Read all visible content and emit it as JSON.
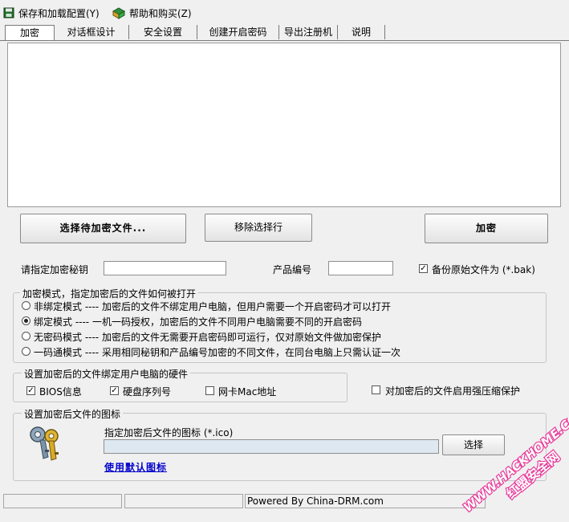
{
  "menu": {
    "save_load": "保存和加载配置(Y)",
    "help_buy": "帮助和购买(Z)"
  },
  "tabs": [
    "加密",
    "对话框设计",
    "安全设置",
    "创建开启密码",
    "导出注册机",
    "说明"
  ],
  "buttons": {
    "select_files": "选择待加密文件...",
    "remove_selected": "移除选择行",
    "encrypt": "加密",
    "choose_icon": "选择"
  },
  "fields": {
    "key_label": "请指定加密秘钥",
    "key_value": "",
    "product_label": "产品编号",
    "product_value": "",
    "backup_label": "备份原始文件为 (*.bak)",
    "backup_checked": true
  },
  "mode_group": {
    "title": "加密模式，指定加密后的文件如何被打开",
    "options": [
      {
        "label": "非绑定模式 ---- 加密后的文件不绑定用户电脑，但用户需要一个开启密码才可以打开",
        "selected": false
      },
      {
        "label": "绑定模式 ---- 一机一码授权，加密后的文件不同用户电脑需要不同的开启密码",
        "selected": true
      },
      {
        "label": "无密码模式 ---- 加密后的文件无需要开启密码即可运行，仅对原始文件做加密保护",
        "selected": false
      },
      {
        "label": "一码通模式 ---- 采用相同秘钥和产品编号加密的不同文件，在同台电脑上只需认证一次",
        "selected": false
      }
    ]
  },
  "hardware_group": {
    "title": "设置加密后的文件绑定用户电脑的硬件",
    "bios": "BIOS信息",
    "disk": "硬盘序列号",
    "mac": "网卡Mac地址",
    "bios_checked": true,
    "disk_checked": true,
    "mac_checked": false
  },
  "compress": {
    "label": "对加密后的文件启用强压缩保护",
    "checked": false
  },
  "icon_group": {
    "title": "设置加密后文件的图标",
    "path_label": "指定加密后文件的图标 (*.ico)",
    "path_value": "",
    "default_link": "使用默认图标"
  },
  "status": {
    "powered": "Powered By China-DRM.com"
  },
  "watermark": {
    "line1": "WWW.HACKHOME.COM",
    "line2": "红盟安全网"
  },
  "colors": {
    "background": "#f0f0f0",
    "link": "#0000cc",
    "watermark": "#e8399a"
  }
}
